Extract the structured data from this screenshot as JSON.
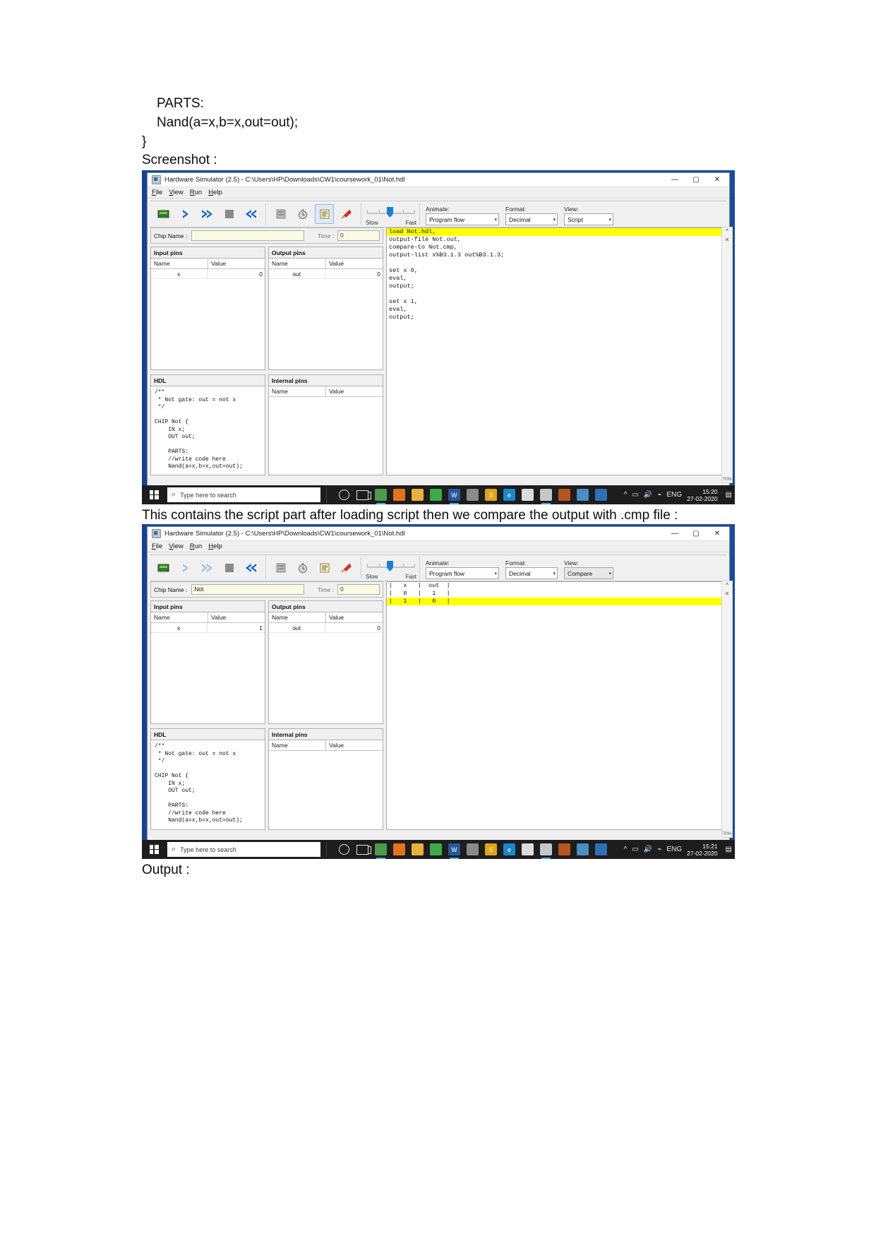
{
  "document": {
    "line_parts": "PARTS:",
    "line_nand": "Nand(a=x,b=x,out=out);",
    "line_brace": "}",
    "label_screenshot": "Screenshot :",
    "caption_middle": "This contains the script part after loading script then we compare the output with .cmp file :",
    "label_output": "Output :"
  },
  "window": {
    "title": "Hardware Simulator (2.5) - C:\\Users\\HP\\Downloads\\CW1\\coursework_01\\Not.hdl",
    "minimize": "—",
    "maximize": "▢",
    "close": "✕",
    "menu": [
      "File",
      "View",
      "Run",
      "Help"
    ],
    "toolbar_icons": [
      "chip-icon",
      "single-step-icon",
      "run-icon",
      "stop-icon",
      "rewind-icon",
      "open-file-icon",
      "clock-icon",
      "script-icon",
      "flag-icon"
    ],
    "speed": {
      "slow_label": "Slow",
      "fast_label": "Fast"
    }
  },
  "shot1": {
    "combos": {
      "animate_label": "Animate:",
      "animate_value": "Program flow",
      "format_label": "Format:",
      "format_value": "Decimal",
      "view_label": "View:",
      "view_value": "Script"
    },
    "chip_name_label": "Chip Name :",
    "chip_name_value": "",
    "time_label": "Time :",
    "time_value": "0",
    "input_pins": {
      "header": "Input pins",
      "columns": [
        "Name",
        "Value"
      ],
      "rows": [
        {
          "name": "x",
          "value": "0"
        }
      ]
    },
    "output_pins": {
      "header": "Output pins",
      "columns": [
        "Name",
        "Value"
      ],
      "rows": [
        {
          "name": "out",
          "value": "0"
        }
      ]
    },
    "hdl": {
      "header": "HDL",
      "code": "/**\n * Not gate: out = not x\n */\n\nCHIP Not {\n    IN x;\n    OUT out;\n\n    PARTS:\n    //write code here\n    Nand(a=x,b=x,out=out);"
    },
    "internal_pins": {
      "header": "Internal pins",
      "columns": [
        "Name",
        "Value"
      ],
      "rows": []
    },
    "script_lines": [
      {
        "text": "load Not.hdl,",
        "highlight": true
      },
      {
        "text": "output-file Not.out,",
        "highlight": false
      },
      {
        "text": "compare-to Not.cmp,",
        "highlight": false
      },
      {
        "text": "output-list x%B3.1.3 out%B3.1.3;",
        "highlight": false
      },
      {
        "text": "",
        "highlight": false
      },
      {
        "text": "set x 0,",
        "highlight": false
      },
      {
        "text": "eval,",
        "highlight": false
      },
      {
        "text": "output;",
        "highlight": false
      },
      {
        "text": "",
        "highlight": false
      },
      {
        "text": "set x 1,",
        "highlight": false
      },
      {
        "text": "eval,",
        "highlight": false
      },
      {
        "text": "output;",
        "highlight": false
      }
    ],
    "gutter": {
      "up": "^",
      "close": "✕",
      "percent": "70%"
    },
    "taskbar": {
      "search_placeholder": "Type here to search",
      "language": "ENG",
      "time": "15:20",
      "date": "27-02-2020"
    }
  },
  "shot2": {
    "combos": {
      "animate_label": "Animate:",
      "animate_value": "Program flow",
      "format_label": "Format:",
      "format_value": "Decimal",
      "view_label": "View:",
      "view_value": "Compare"
    },
    "chip_name_label": "Chip Name :",
    "chip_name_value": "Not",
    "time_label": "Time :",
    "time_value": "0",
    "input_pins": {
      "header": "Input pins",
      "columns": [
        "Name",
        "Value"
      ],
      "rows": [
        {
          "name": "x",
          "value": "1"
        }
      ]
    },
    "output_pins": {
      "header": "Output pins",
      "columns": [
        "Name",
        "Value"
      ],
      "rows": [
        {
          "name": "out",
          "value": "0"
        }
      ]
    },
    "hdl": {
      "header": "HDL",
      "code": "/**\n * Not gate: out = not x\n */\n\nCHIP Not {\n    IN x;\n    OUT out;\n\n    PARTS:\n    //write code here\n    Nand(a=x,b=x,out=out);"
    },
    "internal_pins": {
      "header": "Internal pins",
      "columns": [
        "Name",
        "Value"
      ],
      "rows": []
    },
    "compare_lines": [
      {
        "text": "|   x   |  out  |",
        "highlight": false
      },
      {
        "text": "|   0   |   1   |",
        "highlight": false
      },
      {
        "text": "|   1   |   0   |",
        "highlight": true
      }
    ],
    "gutter": {
      "up": "^",
      "close": "✕",
      "percent": "70%"
    },
    "taskbar": {
      "search_placeholder": "Type here to search",
      "language": "ENG",
      "time": "15:21",
      "date": "27-02-2020"
    }
  }
}
